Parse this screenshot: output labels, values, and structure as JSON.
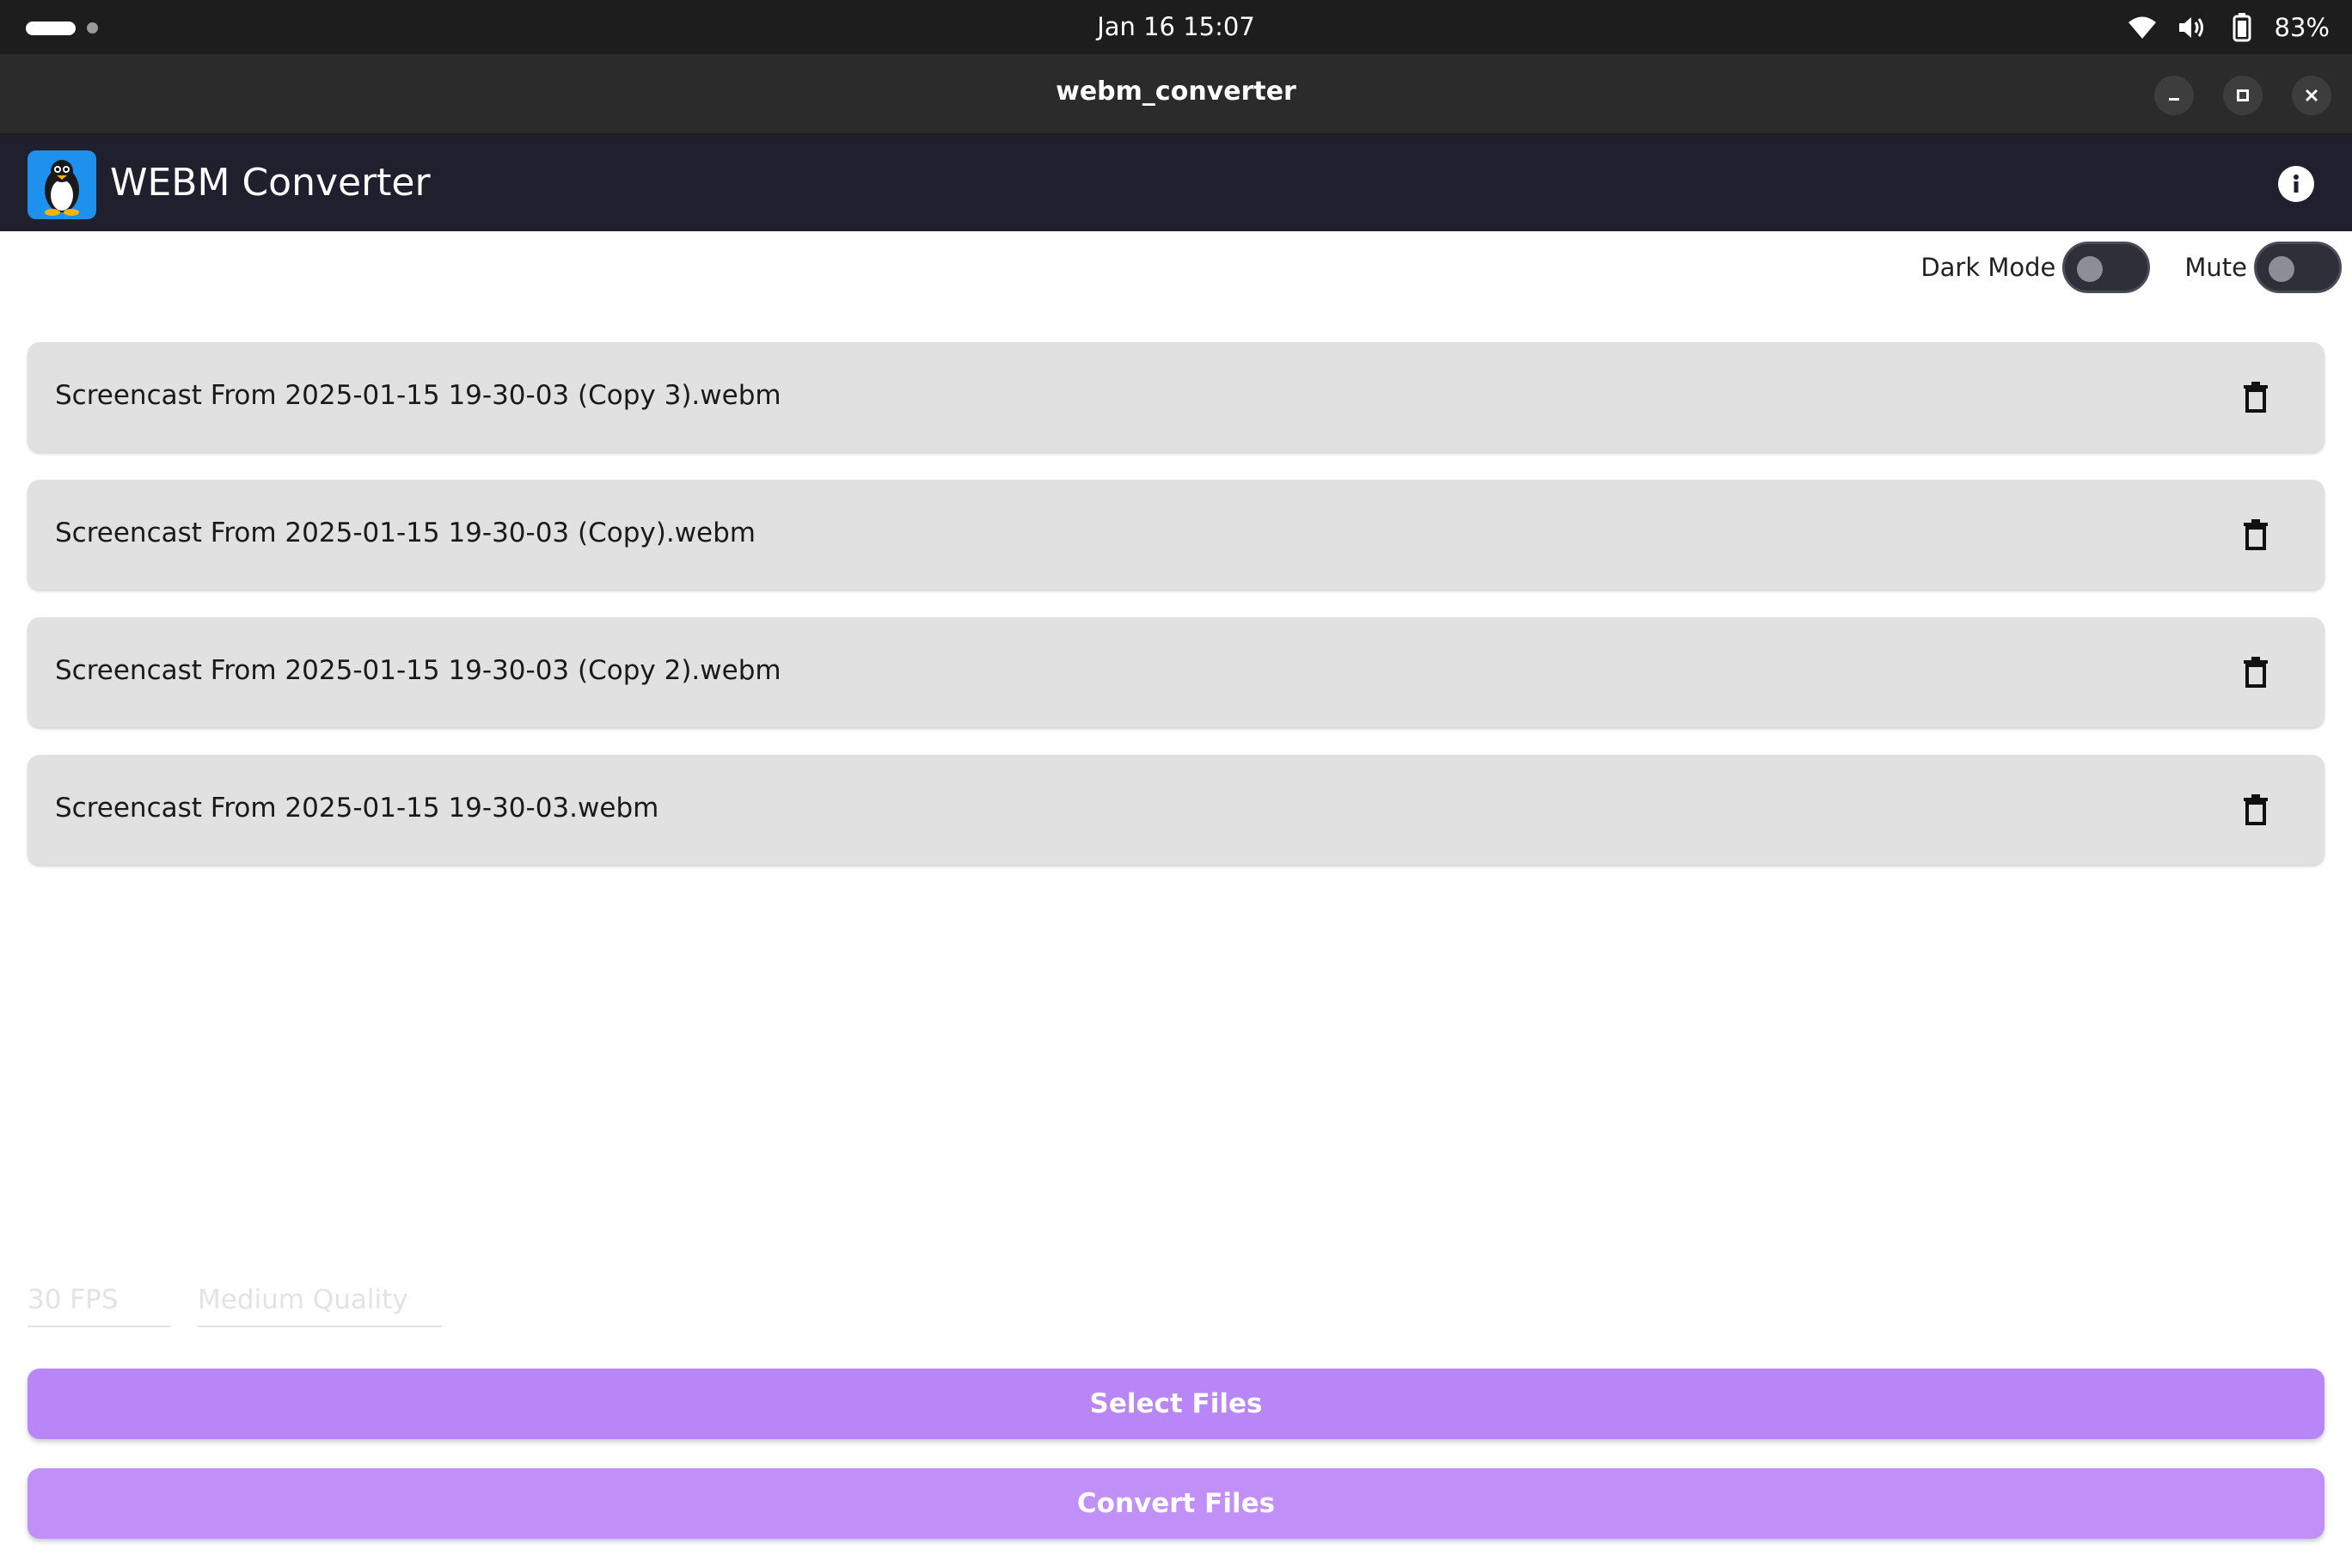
{
  "system_bar": {
    "datetime": "Jan 16  15:07",
    "battery": "83%",
    "icons": [
      "wifi-icon",
      "volume-icon",
      "battery-icon"
    ]
  },
  "window": {
    "title": "webm_converter",
    "controls": [
      "minimize-icon",
      "maximize-icon",
      "close-icon"
    ]
  },
  "appbar": {
    "title": "WEBM Converter",
    "logo_icon": "tux-penguin-icon",
    "info_icon": "info-icon"
  },
  "toggles": {
    "dark_mode_label": "Dark Mode",
    "dark_mode_on": false,
    "mute_label": "Mute",
    "mute_on": false
  },
  "files": [
    "Screencast From 2025-01-15 19-30-03 (Copy 3).webm",
    "Screencast From 2025-01-15 19-30-03 (Copy).webm",
    "Screencast From 2025-01-15 19-30-03 (Copy 2).webm",
    "Screencast From 2025-01-15 19-30-03.webm"
  ],
  "options": {
    "fps": "30 FPS",
    "quality": "Medium Quality"
  },
  "buttons": {
    "select": "Select Files",
    "convert": "Convert Files"
  },
  "colors": {
    "accent": "#b986f7",
    "appbar": "#1f1f2e"
  }
}
